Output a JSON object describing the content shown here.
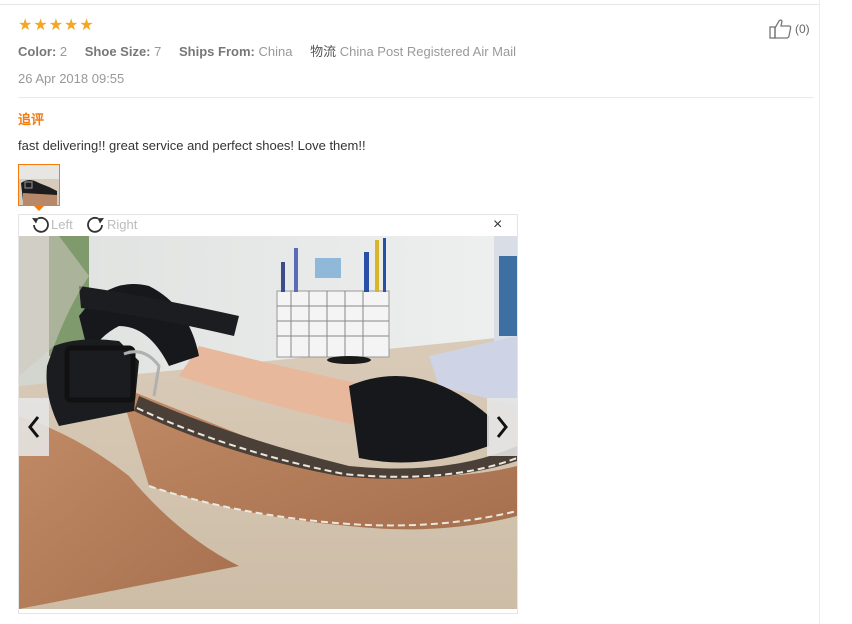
{
  "review": {
    "rating": 5,
    "attributes": [
      {
        "key": "Color:",
        "value": "2"
      },
      {
        "key": "Shoe Size:",
        "value": "7"
      },
      {
        "key": "Ships From:",
        "value": "China"
      },
      {
        "key": "物流",
        "value": "China Post Registered Air Mail"
      }
    ],
    "date": "26 Apr 2018 09:55",
    "helpful_count": "(0)",
    "followup_label": "追评",
    "comment": "fast delivering!! great service and perfect shoes! Love them!!"
  },
  "viewer": {
    "rotate_left": "Left",
    "rotate_right": "Right",
    "close": "×"
  },
  "colors": {
    "accent": "#f57b0f",
    "star": "#f5a623",
    "muted": "#999999"
  },
  "icons": [
    "star-icon",
    "thumbs-up-icon",
    "rotate-left-icon",
    "rotate-right-icon",
    "close-icon",
    "chevron-left-icon",
    "chevron-right-icon"
  ]
}
